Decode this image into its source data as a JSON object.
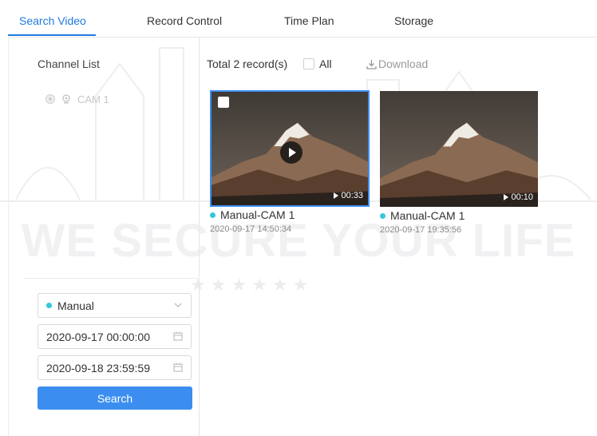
{
  "tabs": [
    {
      "label": "Search Video",
      "active": true
    },
    {
      "label": "Record Control",
      "active": false
    },
    {
      "label": "Time Plan",
      "active": false
    },
    {
      "label": "Storage",
      "active": false
    }
  ],
  "watermark": {
    "text": "WE SECURE YOUR LIFE",
    "stars": "★★★★★★"
  },
  "sidebar": {
    "channel_list_title": "Channel List",
    "channels": [
      {
        "label": "CAM 1",
        "enabled": false
      }
    ],
    "record_type": "Manual",
    "start_time": "2020-09-17 00:00:00",
    "end_time": "2020-09-18 23:59:59",
    "search_label": "Search"
  },
  "results": {
    "total_text": "Total 2 record(s)",
    "all_label": "All",
    "download_label": "Download",
    "records": [
      {
        "name": "Manual-CAM 1",
        "time": "2020-09-17 14:50:34",
        "duration": "00:33",
        "selected": true
      },
      {
        "name": "Manual-CAM 1",
        "time": "2020-09-17 19:35:56",
        "duration": "00:10",
        "selected": false
      }
    ]
  },
  "colors": {
    "accent": "#1e7be0",
    "button": "#3b8ef0",
    "status_dot": "#35c6d9"
  }
}
